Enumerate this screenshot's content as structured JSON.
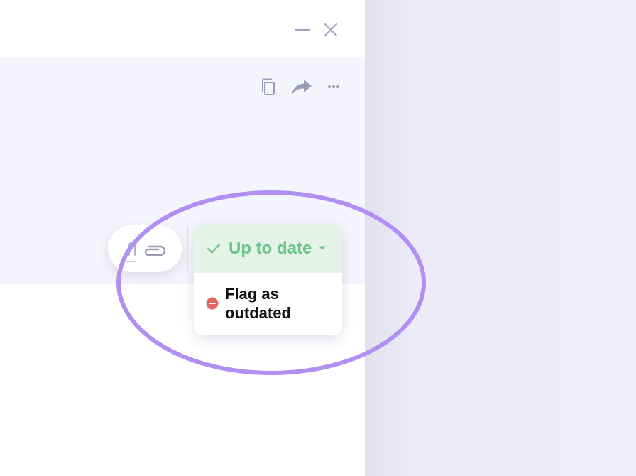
{
  "colors": {
    "accent_ring": "#b08ef2",
    "status_green": "#6cc38a",
    "status_bg": "#e4f3e8",
    "flag_red": "#e2675f",
    "icon_gray": "#9a9bb8"
  },
  "window": {
    "minimize_icon": "minimize-icon",
    "close_icon": "close-icon"
  },
  "card": {
    "actions": [
      "copy-icon",
      "share-icon",
      "more-icon"
    ]
  },
  "attachments": {
    "icon": "paperclip-icon"
  },
  "status": {
    "current": "Up to date",
    "menu": [
      {
        "label": "Flag as outdated",
        "icon": "minus-circle-icon"
      }
    ]
  }
}
